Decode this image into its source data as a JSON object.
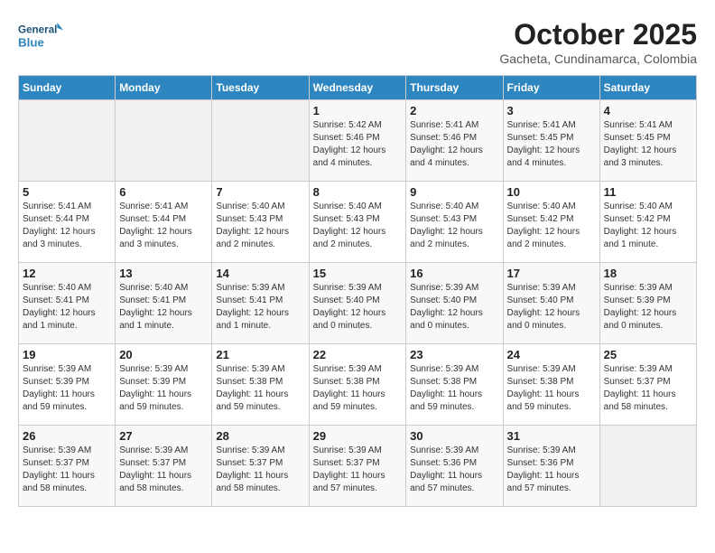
{
  "logo": {
    "line1": "General",
    "line2": "Blue"
  },
  "title": "October 2025",
  "subtitle": "Gacheta, Cundinamarca, Colombia",
  "headers": [
    "Sunday",
    "Monday",
    "Tuesday",
    "Wednesday",
    "Thursday",
    "Friday",
    "Saturday"
  ],
  "weeks": [
    [
      {
        "day": "",
        "info": ""
      },
      {
        "day": "",
        "info": ""
      },
      {
        "day": "",
        "info": ""
      },
      {
        "day": "1",
        "info": "Sunrise: 5:42 AM\nSunset: 5:46 PM\nDaylight: 12 hours\nand 4 minutes."
      },
      {
        "day": "2",
        "info": "Sunrise: 5:41 AM\nSunset: 5:46 PM\nDaylight: 12 hours\nand 4 minutes."
      },
      {
        "day": "3",
        "info": "Sunrise: 5:41 AM\nSunset: 5:45 PM\nDaylight: 12 hours\nand 4 minutes."
      },
      {
        "day": "4",
        "info": "Sunrise: 5:41 AM\nSunset: 5:45 PM\nDaylight: 12 hours\nand 3 minutes."
      }
    ],
    [
      {
        "day": "5",
        "info": "Sunrise: 5:41 AM\nSunset: 5:44 PM\nDaylight: 12 hours\nand 3 minutes."
      },
      {
        "day": "6",
        "info": "Sunrise: 5:41 AM\nSunset: 5:44 PM\nDaylight: 12 hours\nand 3 minutes."
      },
      {
        "day": "7",
        "info": "Sunrise: 5:40 AM\nSunset: 5:43 PM\nDaylight: 12 hours\nand 2 minutes."
      },
      {
        "day": "8",
        "info": "Sunrise: 5:40 AM\nSunset: 5:43 PM\nDaylight: 12 hours\nand 2 minutes."
      },
      {
        "day": "9",
        "info": "Sunrise: 5:40 AM\nSunset: 5:43 PM\nDaylight: 12 hours\nand 2 minutes."
      },
      {
        "day": "10",
        "info": "Sunrise: 5:40 AM\nSunset: 5:42 PM\nDaylight: 12 hours\nand 2 minutes."
      },
      {
        "day": "11",
        "info": "Sunrise: 5:40 AM\nSunset: 5:42 PM\nDaylight: 12 hours\nand 1 minute."
      }
    ],
    [
      {
        "day": "12",
        "info": "Sunrise: 5:40 AM\nSunset: 5:41 PM\nDaylight: 12 hours\nand 1 minute."
      },
      {
        "day": "13",
        "info": "Sunrise: 5:40 AM\nSunset: 5:41 PM\nDaylight: 12 hours\nand 1 minute."
      },
      {
        "day": "14",
        "info": "Sunrise: 5:39 AM\nSunset: 5:41 PM\nDaylight: 12 hours\nand 1 minute."
      },
      {
        "day": "15",
        "info": "Sunrise: 5:39 AM\nSunset: 5:40 PM\nDaylight: 12 hours\nand 0 minutes."
      },
      {
        "day": "16",
        "info": "Sunrise: 5:39 AM\nSunset: 5:40 PM\nDaylight: 12 hours\nand 0 minutes."
      },
      {
        "day": "17",
        "info": "Sunrise: 5:39 AM\nSunset: 5:40 PM\nDaylight: 12 hours\nand 0 minutes."
      },
      {
        "day": "18",
        "info": "Sunrise: 5:39 AM\nSunset: 5:39 PM\nDaylight: 12 hours\nand 0 minutes."
      }
    ],
    [
      {
        "day": "19",
        "info": "Sunrise: 5:39 AM\nSunset: 5:39 PM\nDaylight: 11 hours\nand 59 minutes."
      },
      {
        "day": "20",
        "info": "Sunrise: 5:39 AM\nSunset: 5:39 PM\nDaylight: 11 hours\nand 59 minutes."
      },
      {
        "day": "21",
        "info": "Sunrise: 5:39 AM\nSunset: 5:38 PM\nDaylight: 11 hours\nand 59 minutes."
      },
      {
        "day": "22",
        "info": "Sunrise: 5:39 AM\nSunset: 5:38 PM\nDaylight: 11 hours\nand 59 minutes."
      },
      {
        "day": "23",
        "info": "Sunrise: 5:39 AM\nSunset: 5:38 PM\nDaylight: 11 hours\nand 59 minutes."
      },
      {
        "day": "24",
        "info": "Sunrise: 5:39 AM\nSunset: 5:38 PM\nDaylight: 11 hours\nand 59 minutes."
      },
      {
        "day": "25",
        "info": "Sunrise: 5:39 AM\nSunset: 5:37 PM\nDaylight: 11 hours\nand 58 minutes."
      }
    ],
    [
      {
        "day": "26",
        "info": "Sunrise: 5:39 AM\nSunset: 5:37 PM\nDaylight: 11 hours\nand 58 minutes."
      },
      {
        "day": "27",
        "info": "Sunrise: 5:39 AM\nSunset: 5:37 PM\nDaylight: 11 hours\nand 58 minutes."
      },
      {
        "day": "28",
        "info": "Sunrise: 5:39 AM\nSunset: 5:37 PM\nDaylight: 11 hours\nand 58 minutes."
      },
      {
        "day": "29",
        "info": "Sunrise: 5:39 AM\nSunset: 5:37 PM\nDaylight: 11 hours\nand 57 minutes."
      },
      {
        "day": "30",
        "info": "Sunrise: 5:39 AM\nSunset: 5:36 PM\nDaylight: 11 hours\nand 57 minutes."
      },
      {
        "day": "31",
        "info": "Sunrise: 5:39 AM\nSunset: 5:36 PM\nDaylight: 11 hours\nand 57 minutes."
      },
      {
        "day": "",
        "info": ""
      }
    ]
  ]
}
